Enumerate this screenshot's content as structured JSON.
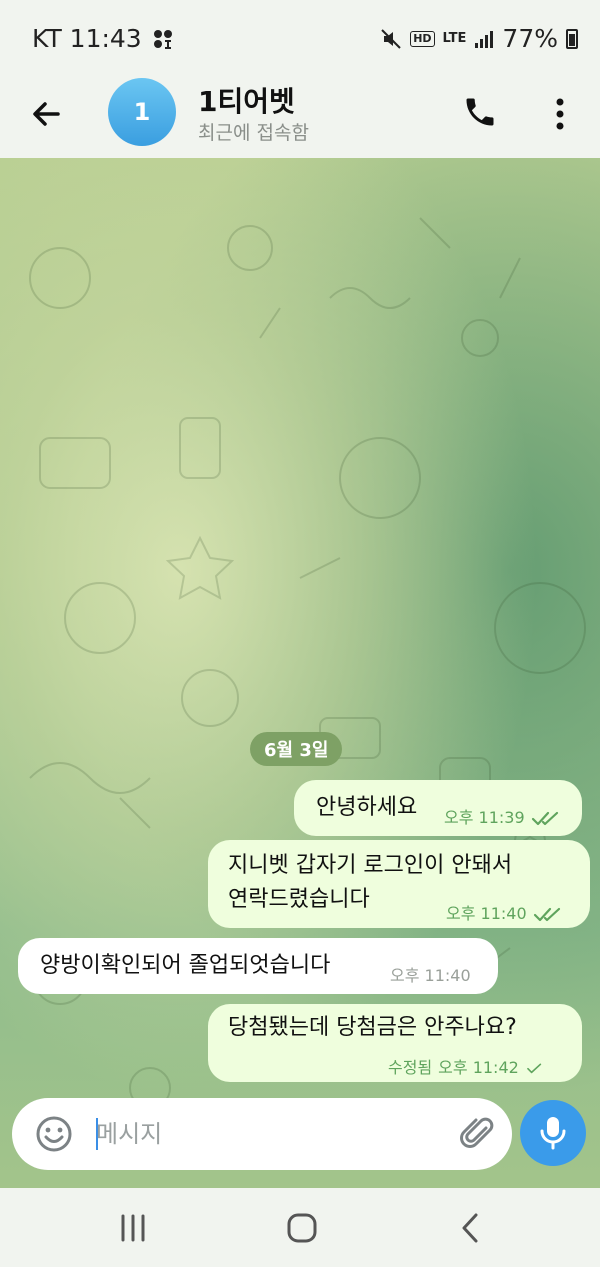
{
  "status_bar": {
    "carrier_time": "KT 11:43",
    "network": "LTE",
    "battery": "77%"
  },
  "header": {
    "avatar_letter": "1",
    "title": "1티어벳",
    "subtitle": "최근에 접속함"
  },
  "chat": {
    "date_label": "6월 3일",
    "messages": [
      {
        "direction": "out",
        "lines": [
          "안녕하세요"
        ],
        "time": "오후 11:39",
        "status": "read"
      },
      {
        "direction": "out",
        "lines": [
          "지니벳 갑자기 로그인이 안돼서",
          "연락드렸습니다"
        ],
        "time": "오후 11:40",
        "status": "read"
      },
      {
        "direction": "in",
        "lines": [
          "양방이확인되어 졸업되엇습니다"
        ],
        "time": "오후 11:40"
      },
      {
        "direction": "out",
        "lines": [
          "당첨됐는데 당첨금은 안주나요?"
        ],
        "edited": "수정됨",
        "time": "오후 11:42",
        "status": "sent"
      }
    ]
  },
  "input": {
    "placeholder": "메시지"
  },
  "colors": {
    "accent": "#3a9bea",
    "out_bubble": "#effedd",
    "in_bubble": "#ffffff",
    "check_color": "#5fa45d",
    "date_pill": "#7ea165"
  },
  "icons": [
    "back-arrow-icon",
    "phone-icon",
    "more-vert-icon",
    "emoji-icon",
    "paperclip-icon",
    "mic-icon",
    "mute-icon",
    "signal-icon",
    "battery-icon"
  ]
}
